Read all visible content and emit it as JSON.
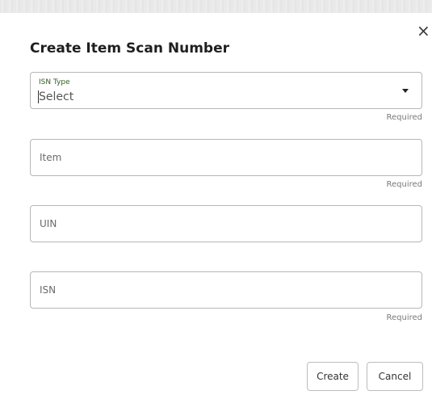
{
  "dialog": {
    "title": "Create Item Scan Number",
    "close_icon": "close-icon"
  },
  "fields": {
    "isn_type": {
      "label": "ISN Type",
      "value": "Select",
      "helper": "Required"
    },
    "item": {
      "placeholder": "Item",
      "helper": "Required"
    },
    "uin": {
      "placeholder": "UIN"
    },
    "isn": {
      "placeholder": "ISN",
      "helper": "Required"
    }
  },
  "buttons": {
    "create": "Create",
    "cancel": "Cancel"
  }
}
